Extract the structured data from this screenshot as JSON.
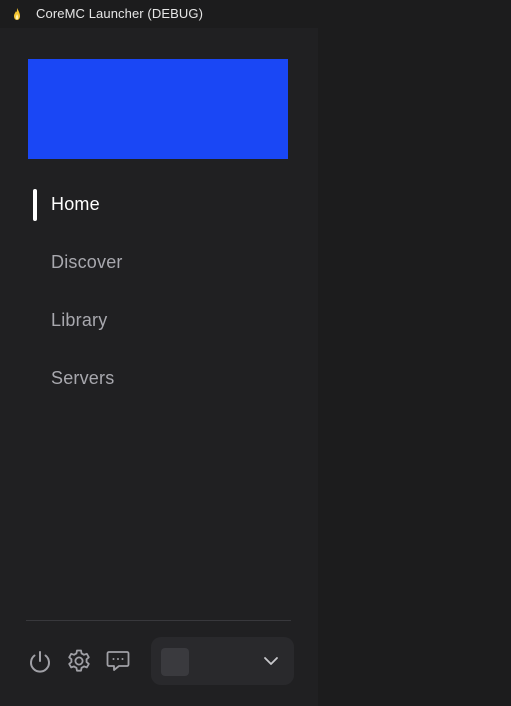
{
  "window": {
    "title": "CoreMC Launcher (DEBUG)",
    "icon": "flame-icon"
  },
  "sidebar": {
    "banner_color": "#1a47f5",
    "nav": [
      {
        "label": "Home",
        "active": true
      },
      {
        "label": "Discover",
        "active": false
      },
      {
        "label": "Library",
        "active": false
      },
      {
        "label": "Servers",
        "active": false
      }
    ],
    "footer": {
      "icons": [
        "power-icon",
        "gear-icon",
        "chat-icon"
      ],
      "account_select": {
        "icon": "chevron-down-icon"
      }
    }
  },
  "colors": {
    "background": "#1c1c1d",
    "sidebar": "#202022",
    "accent": "#1a47f5",
    "text_active": "#ffffff",
    "text_inactive": "#a8a8ae"
  }
}
